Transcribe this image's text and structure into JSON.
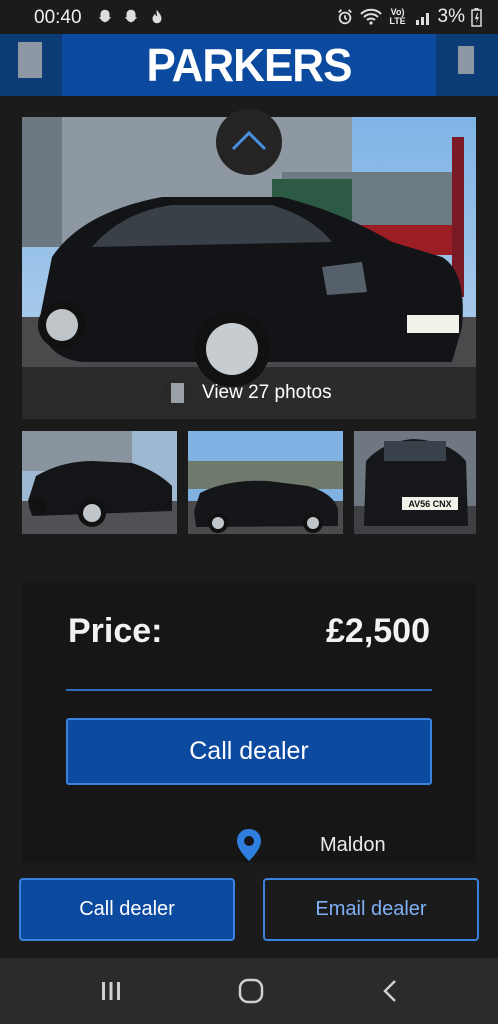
{
  "status_bar": {
    "time": "00:40",
    "battery": "3%",
    "network": "Vo) LTE"
  },
  "header": {
    "logo": "PARKERS"
  },
  "gallery": {
    "view_photos": "View 27 photos",
    "main_plate": "AV56 CNX",
    "thumb_plate": "AV56 CNX"
  },
  "listing": {
    "price_label": "Price:",
    "price_value": "£2,500",
    "call_button": "Call dealer",
    "location": "Maldon"
  },
  "cta": {
    "call": "Call dealer",
    "email": "Email dealer"
  },
  "colors": {
    "brand_blue": "#0b4a9f",
    "header_dark": "#0c3c76",
    "accent_border": "#3a82e0",
    "background": "#1b1b1c"
  },
  "icons": [
    "snapchat-icon",
    "fire-icon",
    "alarm-icon",
    "wifi-icon",
    "signal-icon",
    "battery-icon",
    "menu-icon",
    "account-icon",
    "chevron-up-icon",
    "camera-icon",
    "location-pin-icon",
    "recent-apps-icon",
    "home-icon",
    "back-icon"
  ]
}
